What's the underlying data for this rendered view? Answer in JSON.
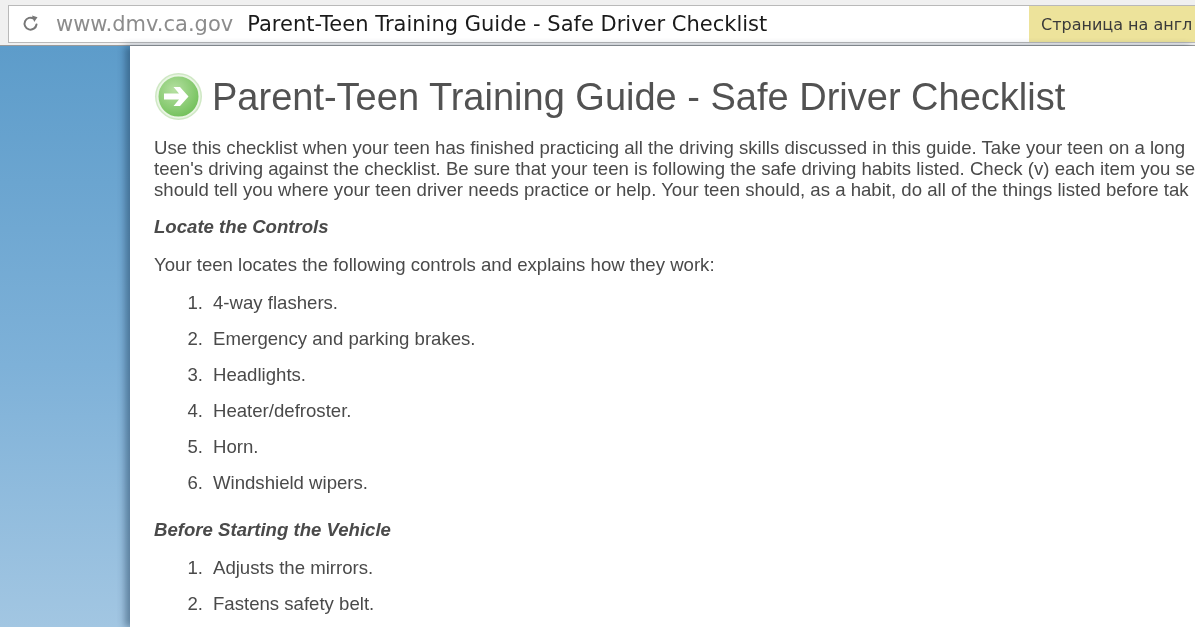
{
  "browser": {
    "url": "www.dmv.ca.gov",
    "page_title": "Parent-Teen Training Guide - Safe Driver Checklist",
    "translate_prompt": "Страница на англ"
  },
  "page": {
    "title": "Parent-Teen Training Guide - Safe Driver Checklist",
    "intro": {
      "lines": [
        "Use this checklist when your teen has finished practicing all the driving skills discussed in this guide. Take your teen on a long",
        "teen's driving against the checklist. Be sure that your teen is following the safe driving habits listed. Check (v) each item you se",
        "should tell you where your teen driver needs practice or help. Your teen should, as a habit, do all of the things listed before tak"
      ]
    },
    "sections": [
      {
        "heading": "Locate the Controls",
        "lead": "Your teen locates the following controls and explains how they work:",
        "items": [
          {
            "number": "1.",
            "text": "4-way flashers."
          },
          {
            "number": "2.",
            "text": "Emergency and parking brakes."
          },
          {
            "number": "3.",
            "text": "Headlights."
          },
          {
            "number": "4.",
            "text": "Heater/defroster."
          },
          {
            "number": "5.",
            "text": "Horn."
          },
          {
            "number": "6.",
            "text": "Windshield wipers."
          }
        ]
      },
      {
        "heading": "Before Starting the Vehicle",
        "items": [
          {
            "number": "1.",
            "text": "Adjusts the mirrors."
          },
          {
            "number": "2.",
            "text": "Fastens safety belt."
          }
        ]
      }
    ]
  }
}
